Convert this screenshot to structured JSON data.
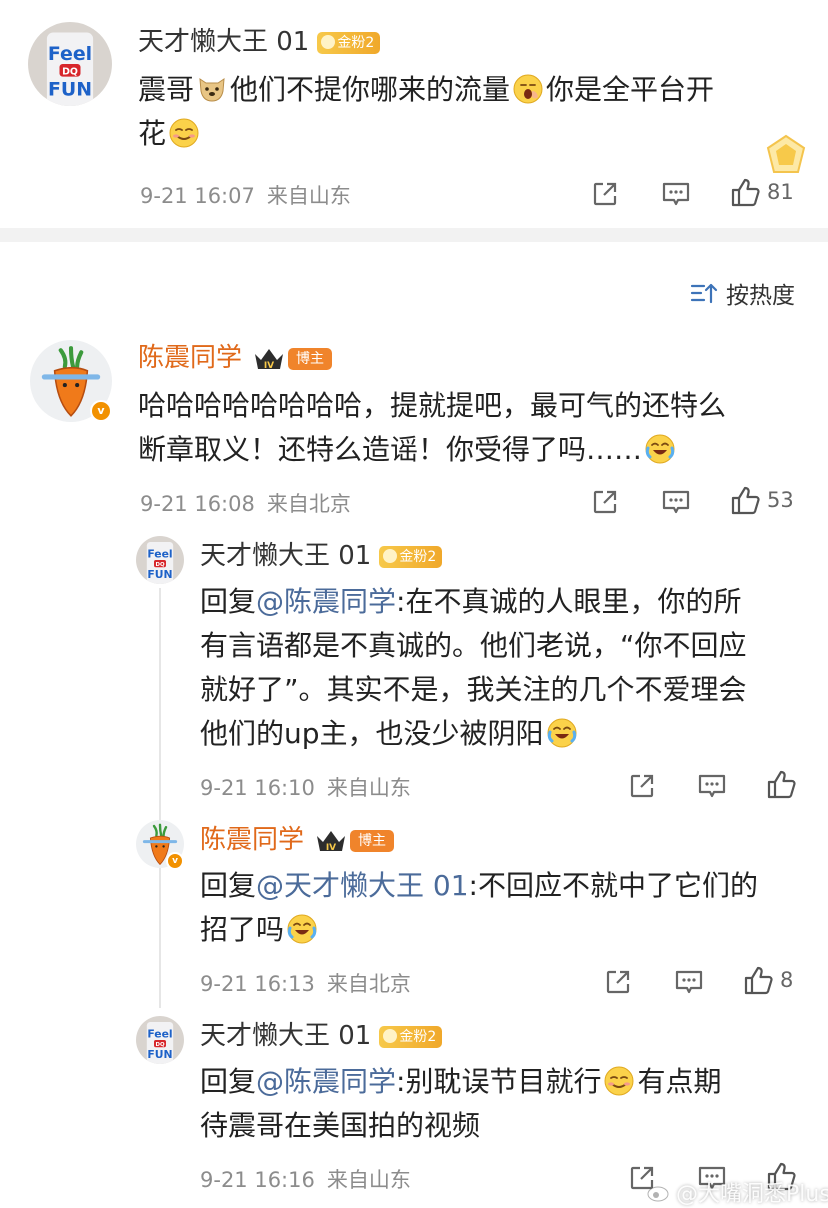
{
  "top_comment": {
    "username": "天才懒大王 01",
    "badge": "金粉2",
    "text_line1_a": "震哥",
    "text_line1_b": "他们不提你哪来的流量",
    "text_line1_c": "你是全平台开",
    "text_line2": "花",
    "meta_date": "9-21 16:07",
    "meta_location": "来自山东",
    "like_count": "81"
  },
  "sort": {
    "label": "按热度"
  },
  "main_comment": {
    "username": "陈震同学",
    "badge": "博主",
    "text_line1": "哈哈哈哈哈哈哈哈，提就提吧，最可气的还特么",
    "text_line2": "断章取义！还特么造谣！你受得了吗……",
    "meta_date": "9-21 16:08",
    "meta_location": "来自北京",
    "like_count": "53"
  },
  "replies": [
    {
      "username": "天才懒大王 01",
      "badge": "金粉2",
      "reply_prefix": "回复",
      "mention": "@陈震同学",
      "line1": ":在不真诚的人眼里，你的所",
      "line2": "有言语都是不真诚的。他们老说，“你不回应",
      "line3": "就好了”。其实不是，我关注的几个不爱理会",
      "line4": "他们的up主，也没少被阴阳",
      "meta_date": "9-21 16:10",
      "meta_location": "来自山东",
      "like_count": ""
    },
    {
      "username": "陈震同学",
      "badge": "博主",
      "reply_prefix": "回复",
      "mention": "@天才懒大王 01",
      "line1": ":不回应不就中了它们的",
      "line2": "招了吗",
      "meta_date": "9-21 16:13",
      "meta_location": "来自北京",
      "like_count": "8"
    },
    {
      "username": "天才懒大王 01",
      "badge": "金粉2",
      "reply_prefix": "回复",
      "mention": "@陈震同学",
      "line1": ":别耽误节目就行",
      "line1_b": "有点期",
      "line2": "待震哥在美国拍的视频",
      "meta_date": "9-21 16:16",
      "meta_location": "来自山东",
      "like_count": ""
    }
  ],
  "watermark": "@大嘴洞悉Plus",
  "avatar_text": "DQ FUN"
}
